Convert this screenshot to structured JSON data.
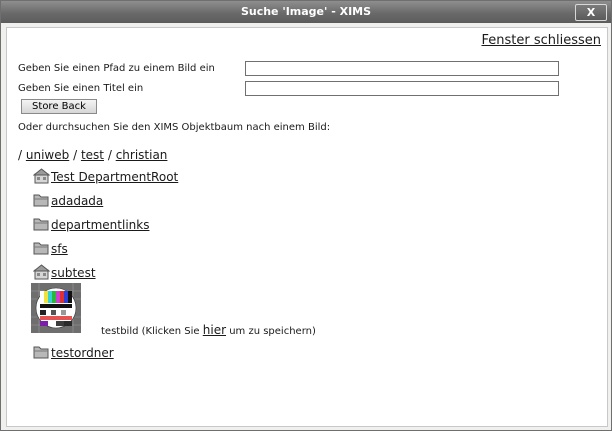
{
  "window": {
    "title": "Suche 'Image' - XIMS",
    "close_button": "X"
  },
  "close_link": "Fenster schliessen",
  "form": {
    "path_label": "Geben Sie einen Pfad zu einem Bild ein",
    "path_value": "",
    "title_label": "Geben Sie einen Titel ein",
    "title_value": "",
    "store_back": "Store Back",
    "browse_text": "Oder durchsuchen Sie den XIMS Objektbaum nach einem Bild:"
  },
  "breadcrumb": {
    "sep": "/",
    "items": [
      "uniweb",
      "test",
      "christian"
    ]
  },
  "tree": [
    {
      "label": "Test DepartmentRoot",
      "icon": "department-icon"
    },
    {
      "label": "adadada",
      "icon": "folder-icon"
    },
    {
      "label": "departmentlinks",
      "icon": "folder-icon"
    },
    {
      "label": "sfs",
      "icon": "folder-icon"
    },
    {
      "label": "subtest",
      "icon": "department-icon"
    }
  ],
  "image_item": {
    "name": "testbild",
    "pre": "(Klicken Sie",
    "link": "hier",
    "post": "um zu speichern)"
  },
  "last_folder": {
    "label": "testordner",
    "icon": "folder-icon"
  }
}
